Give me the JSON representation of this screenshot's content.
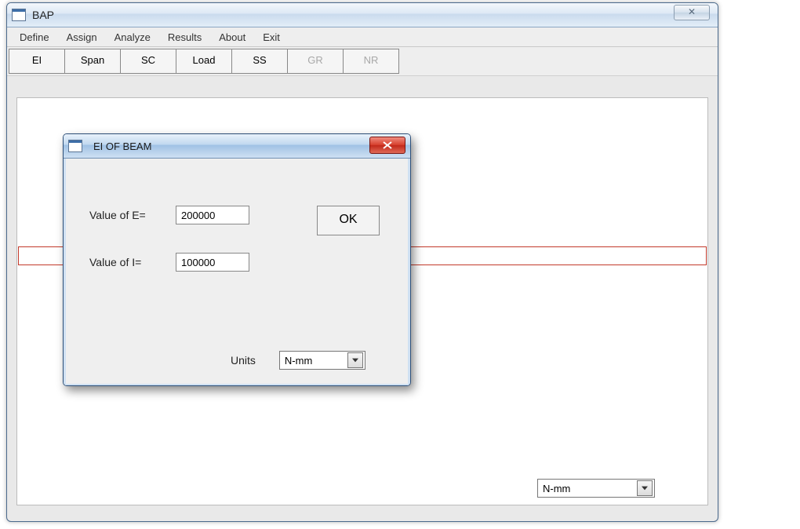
{
  "main_window": {
    "title": "BAP",
    "close_symbol": "✕"
  },
  "menubar": {
    "items": [
      "Define",
      "Assign",
      "Analyze",
      "Results",
      "About",
      "Exit"
    ]
  },
  "toolbar": {
    "buttons": [
      {
        "label": "EI",
        "disabled": false
      },
      {
        "label": "Span",
        "disabled": false
      },
      {
        "label": "SC",
        "disabled": false
      },
      {
        "label": "Load",
        "disabled": false
      },
      {
        "label": "SS",
        "disabled": false
      },
      {
        "label": "GR",
        "disabled": true
      },
      {
        "label": "NR",
        "disabled": true
      }
    ]
  },
  "bottom_select": {
    "value": "N-mm"
  },
  "dialog": {
    "title": "EI OF BEAM",
    "label_e": "Value of E=",
    "value_e": "200000",
    "label_i": "Value of I=",
    "value_i": "100000",
    "ok_label": "OK",
    "units_label": "Units",
    "units_value": "N-mm"
  }
}
